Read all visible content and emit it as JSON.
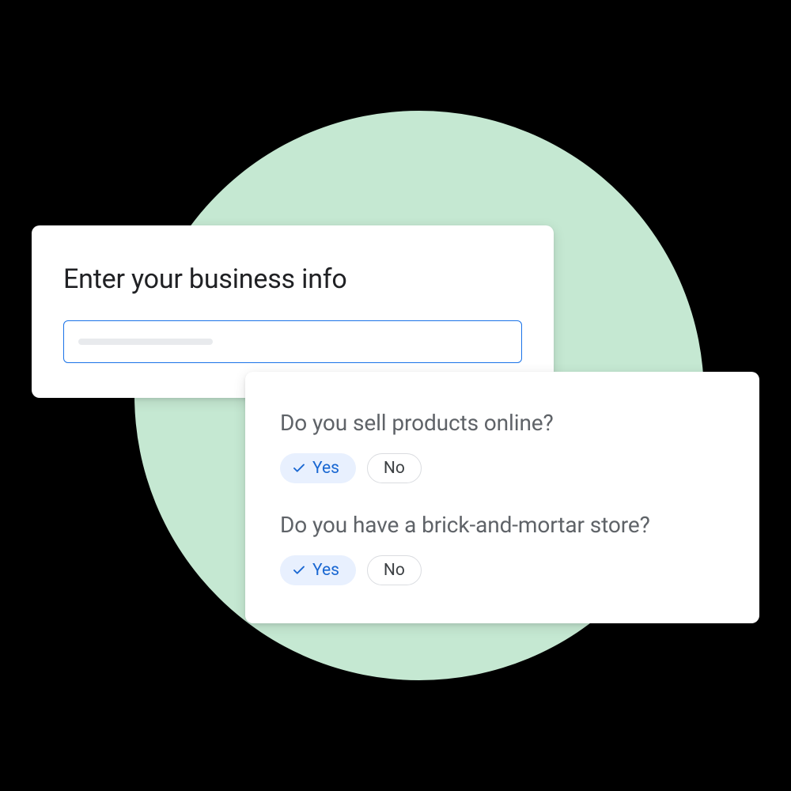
{
  "card1": {
    "title": "Enter your business info"
  },
  "card2": {
    "question1": "Do you sell products online?",
    "question2": "Do you have a brick-and-mortar store?",
    "yes_label": "Yes",
    "no_label": "No"
  }
}
